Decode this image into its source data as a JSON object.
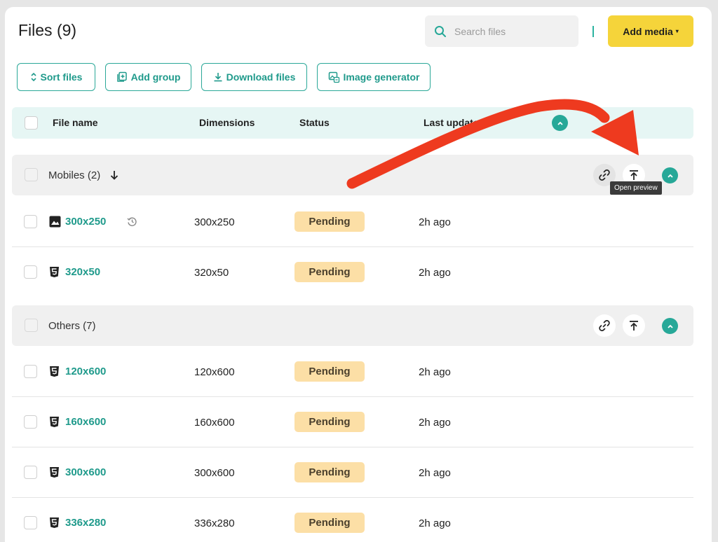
{
  "header": {
    "title": "Files (9)",
    "search_placeholder": "Search files",
    "add_media_label": "Add media",
    "add_media_caret": "▾"
  },
  "toolbar": {
    "sort_label": "Sort files",
    "add_group_label": "Add group",
    "download_label": "Download files",
    "image_generator_label": "Image generator"
  },
  "table": {
    "columns": [
      "File name",
      "Dimensions",
      "Status",
      "Last update"
    ]
  },
  "groups": [
    {
      "label": "Mobiles (2)",
      "tooltip": "Open preview",
      "files": [
        {
          "name": "300x250",
          "type": "image-icon",
          "dimensions": "300x250",
          "status": "Pending",
          "updated": "2h ago",
          "history": true
        },
        {
          "name": "320x50",
          "type": "html5-icon",
          "dimensions": "320x50",
          "status": "Pending",
          "updated": "2h ago"
        }
      ]
    },
    {
      "label": "Others (7)",
      "files": [
        {
          "name": "120x600",
          "type": "html5-icon",
          "dimensions": "120x600",
          "status": "Pending",
          "updated": "2h ago"
        },
        {
          "name": "160x600",
          "type": "html5-icon",
          "dimensions": "160x600",
          "status": "Pending",
          "updated": "2h ago"
        },
        {
          "name": "300x600",
          "type": "html5-icon",
          "dimensions": "300x600",
          "status": "Pending",
          "updated": "2h ago"
        },
        {
          "name": "336x280",
          "type": "html5-icon",
          "dimensions": "336x280",
          "status": "Pending",
          "updated": "2h ago"
        }
      ]
    }
  ],
  "colors": {
    "accent": "#27a898",
    "add_media_bg": "#f5d43a",
    "pending_bg": "#fcdfa6",
    "annotation_arrow": "#ee3a1f"
  }
}
